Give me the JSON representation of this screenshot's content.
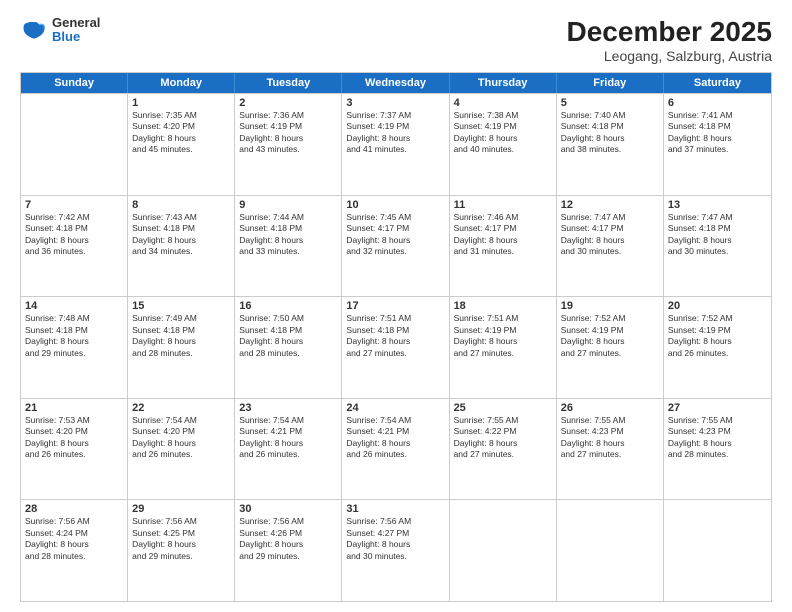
{
  "header": {
    "logo_general": "General",
    "logo_blue": "Blue",
    "main_title": "December 2025",
    "subtitle": "Leogang, Salzburg, Austria"
  },
  "calendar": {
    "days_of_week": [
      "Sunday",
      "Monday",
      "Tuesday",
      "Wednesday",
      "Thursday",
      "Friday",
      "Saturday"
    ],
    "rows": [
      [
        {
          "day": "",
          "info": ""
        },
        {
          "day": "1",
          "info": "Sunrise: 7:35 AM\nSunset: 4:20 PM\nDaylight: 8 hours\nand 45 minutes."
        },
        {
          "day": "2",
          "info": "Sunrise: 7:36 AM\nSunset: 4:19 PM\nDaylight: 8 hours\nand 43 minutes."
        },
        {
          "day": "3",
          "info": "Sunrise: 7:37 AM\nSunset: 4:19 PM\nDaylight: 8 hours\nand 41 minutes."
        },
        {
          "day": "4",
          "info": "Sunrise: 7:38 AM\nSunset: 4:19 PM\nDaylight: 8 hours\nand 40 minutes."
        },
        {
          "day": "5",
          "info": "Sunrise: 7:40 AM\nSunset: 4:18 PM\nDaylight: 8 hours\nand 38 minutes."
        },
        {
          "day": "6",
          "info": "Sunrise: 7:41 AM\nSunset: 4:18 PM\nDaylight: 8 hours\nand 37 minutes."
        }
      ],
      [
        {
          "day": "7",
          "info": "Sunrise: 7:42 AM\nSunset: 4:18 PM\nDaylight: 8 hours\nand 36 minutes."
        },
        {
          "day": "8",
          "info": "Sunrise: 7:43 AM\nSunset: 4:18 PM\nDaylight: 8 hours\nand 34 minutes."
        },
        {
          "day": "9",
          "info": "Sunrise: 7:44 AM\nSunset: 4:18 PM\nDaylight: 8 hours\nand 33 minutes."
        },
        {
          "day": "10",
          "info": "Sunrise: 7:45 AM\nSunset: 4:17 PM\nDaylight: 8 hours\nand 32 minutes."
        },
        {
          "day": "11",
          "info": "Sunrise: 7:46 AM\nSunset: 4:17 PM\nDaylight: 8 hours\nand 31 minutes."
        },
        {
          "day": "12",
          "info": "Sunrise: 7:47 AM\nSunset: 4:17 PM\nDaylight: 8 hours\nand 30 minutes."
        },
        {
          "day": "13",
          "info": "Sunrise: 7:47 AM\nSunset: 4:18 PM\nDaylight: 8 hours\nand 30 minutes."
        }
      ],
      [
        {
          "day": "14",
          "info": "Sunrise: 7:48 AM\nSunset: 4:18 PM\nDaylight: 8 hours\nand 29 minutes."
        },
        {
          "day": "15",
          "info": "Sunrise: 7:49 AM\nSunset: 4:18 PM\nDaylight: 8 hours\nand 28 minutes."
        },
        {
          "day": "16",
          "info": "Sunrise: 7:50 AM\nSunset: 4:18 PM\nDaylight: 8 hours\nand 28 minutes."
        },
        {
          "day": "17",
          "info": "Sunrise: 7:51 AM\nSunset: 4:18 PM\nDaylight: 8 hours\nand 27 minutes."
        },
        {
          "day": "18",
          "info": "Sunrise: 7:51 AM\nSunset: 4:19 PM\nDaylight: 8 hours\nand 27 minutes."
        },
        {
          "day": "19",
          "info": "Sunrise: 7:52 AM\nSunset: 4:19 PM\nDaylight: 8 hours\nand 27 minutes."
        },
        {
          "day": "20",
          "info": "Sunrise: 7:52 AM\nSunset: 4:19 PM\nDaylight: 8 hours\nand 26 minutes."
        }
      ],
      [
        {
          "day": "21",
          "info": "Sunrise: 7:53 AM\nSunset: 4:20 PM\nDaylight: 8 hours\nand 26 minutes."
        },
        {
          "day": "22",
          "info": "Sunrise: 7:54 AM\nSunset: 4:20 PM\nDaylight: 8 hours\nand 26 minutes."
        },
        {
          "day": "23",
          "info": "Sunrise: 7:54 AM\nSunset: 4:21 PM\nDaylight: 8 hours\nand 26 minutes."
        },
        {
          "day": "24",
          "info": "Sunrise: 7:54 AM\nSunset: 4:21 PM\nDaylight: 8 hours\nand 26 minutes."
        },
        {
          "day": "25",
          "info": "Sunrise: 7:55 AM\nSunset: 4:22 PM\nDaylight: 8 hours\nand 27 minutes."
        },
        {
          "day": "26",
          "info": "Sunrise: 7:55 AM\nSunset: 4:23 PM\nDaylight: 8 hours\nand 27 minutes."
        },
        {
          "day": "27",
          "info": "Sunrise: 7:55 AM\nSunset: 4:23 PM\nDaylight: 8 hours\nand 28 minutes."
        }
      ],
      [
        {
          "day": "28",
          "info": "Sunrise: 7:56 AM\nSunset: 4:24 PM\nDaylight: 8 hours\nand 28 minutes."
        },
        {
          "day": "29",
          "info": "Sunrise: 7:56 AM\nSunset: 4:25 PM\nDaylight: 8 hours\nand 29 minutes."
        },
        {
          "day": "30",
          "info": "Sunrise: 7:56 AM\nSunset: 4:26 PM\nDaylight: 8 hours\nand 29 minutes."
        },
        {
          "day": "31",
          "info": "Sunrise: 7:56 AM\nSunset: 4:27 PM\nDaylight: 8 hours\nand 30 minutes."
        },
        {
          "day": "",
          "info": ""
        },
        {
          "day": "",
          "info": ""
        },
        {
          "day": "",
          "info": ""
        }
      ]
    ]
  }
}
